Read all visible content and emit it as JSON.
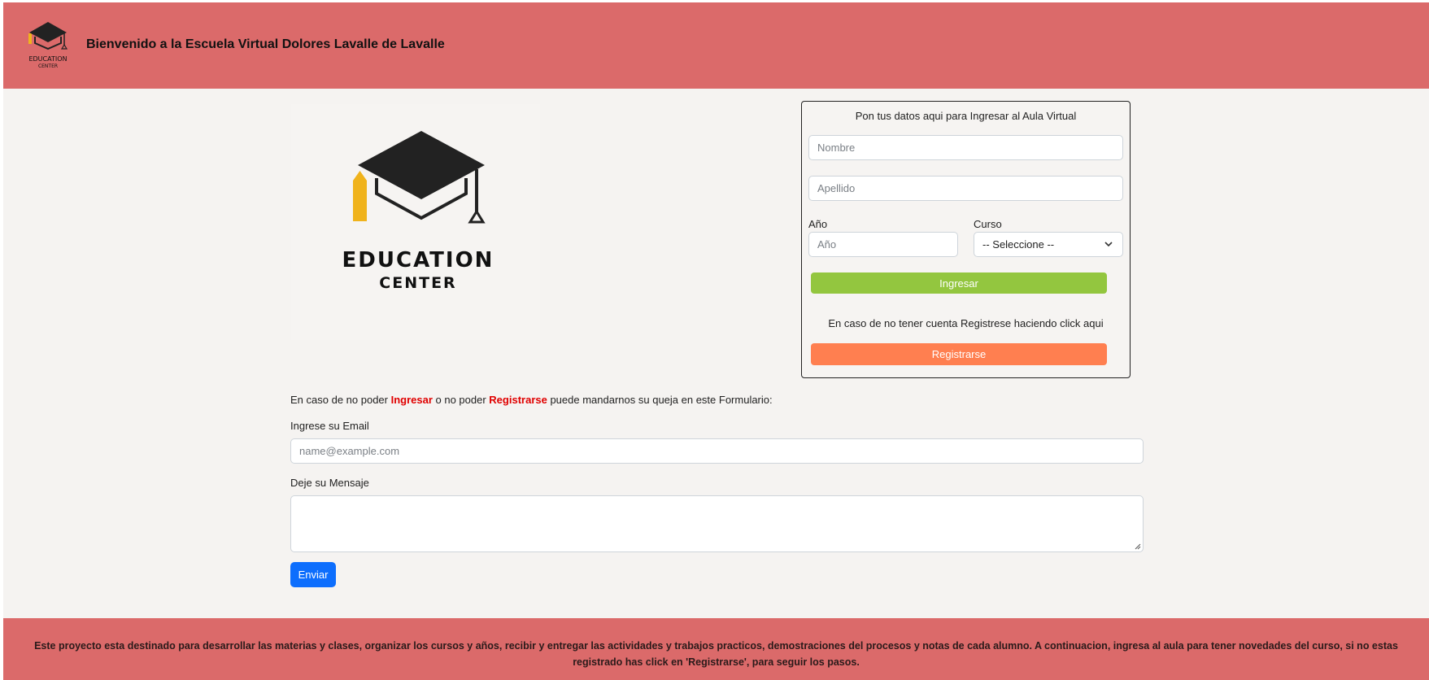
{
  "header": {
    "title": "Bienvenido a la Escuela Virtual Dolores Lavalle de Lavalle",
    "logo": {
      "line1": "EDUCATION",
      "line2": "CENTER",
      "icon": "graduation-cap-icon"
    },
    "background": "#db6a6a"
  },
  "hero_logo": {
    "line1": "EDUCATION",
    "line2": "CENTER",
    "icon": "graduation-cap-icon",
    "accent": "#f0b31c"
  },
  "login": {
    "title": "Pon tus datos aqui para Ingresar al Aula Virtual",
    "nombre_placeholder": "Nombre",
    "apellido_placeholder": "Apellido",
    "anio_label": "Año",
    "anio_placeholder": "Año",
    "curso_label": "Curso",
    "curso_selected": "-- Seleccione --",
    "ingresar_label": "Ingresar",
    "register_hint": "En caso de no tener cuenta Registrese haciendo click aqui",
    "registrarse_label": "Registrarse",
    "colors": {
      "ingresar": "#93c63f",
      "registrarse": "#ff7f50"
    }
  },
  "complaint": {
    "text_before": "En caso de no poder ",
    "ingresar_word": "Ingresar",
    "text_middle": " o no poder ",
    "registrarse_word": "Registrarse",
    "text_after": " puede mandarnos su queja en este Formulario:",
    "email_label": "Ingrese su Email",
    "email_placeholder": "name@example.com",
    "message_label": "Deje su Mensaje",
    "message_value": "",
    "submit_label": "Enviar",
    "highlight_color": "#e00000",
    "submit_color": "#0d6efd"
  },
  "footer": {
    "text": "Este proyecto esta destinado para desarrollar las materias y clases, organizar los cursos y años, recibir y entregar las actividades y trabajos practicos, demostraciones del procesos y notas de cada alumno. A continuacion, ingresa al aula para tener novedades del curso, si no estas registrado has click en 'Registrarse', para seguir los pasos."
  }
}
